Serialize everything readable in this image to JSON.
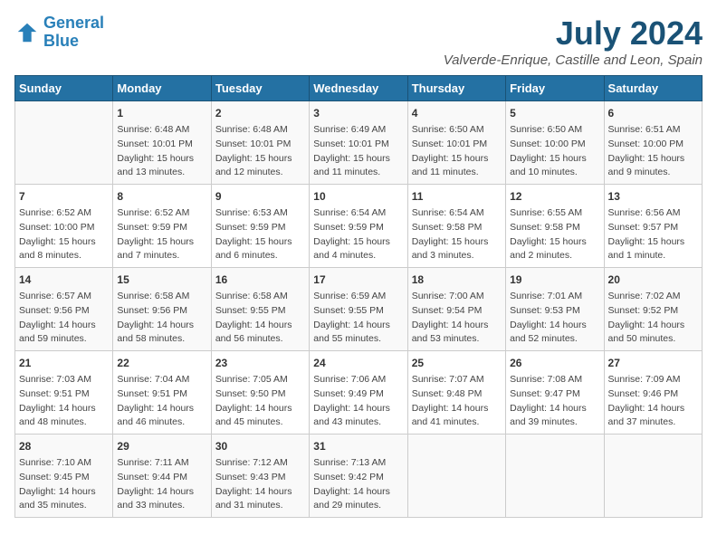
{
  "header": {
    "logo_line1": "General",
    "logo_line2": "Blue",
    "title": "July 2024",
    "subtitle": "Valverde-Enrique, Castille and Leon, Spain"
  },
  "days_of_week": [
    "Sunday",
    "Monday",
    "Tuesday",
    "Wednesday",
    "Thursday",
    "Friday",
    "Saturday"
  ],
  "weeks": [
    [
      {
        "day": "",
        "info": ""
      },
      {
        "day": "1",
        "info": "Sunrise: 6:48 AM\nSunset: 10:01 PM\nDaylight: 15 hours\nand 13 minutes."
      },
      {
        "day": "2",
        "info": "Sunrise: 6:48 AM\nSunset: 10:01 PM\nDaylight: 15 hours\nand 12 minutes."
      },
      {
        "day": "3",
        "info": "Sunrise: 6:49 AM\nSunset: 10:01 PM\nDaylight: 15 hours\nand 11 minutes."
      },
      {
        "day": "4",
        "info": "Sunrise: 6:50 AM\nSunset: 10:01 PM\nDaylight: 15 hours\nand 11 minutes."
      },
      {
        "day": "5",
        "info": "Sunrise: 6:50 AM\nSunset: 10:00 PM\nDaylight: 15 hours\nand 10 minutes."
      },
      {
        "day": "6",
        "info": "Sunrise: 6:51 AM\nSunset: 10:00 PM\nDaylight: 15 hours\nand 9 minutes."
      }
    ],
    [
      {
        "day": "7",
        "info": "Sunrise: 6:52 AM\nSunset: 10:00 PM\nDaylight: 15 hours\nand 8 minutes."
      },
      {
        "day": "8",
        "info": "Sunrise: 6:52 AM\nSunset: 9:59 PM\nDaylight: 15 hours\nand 7 minutes."
      },
      {
        "day": "9",
        "info": "Sunrise: 6:53 AM\nSunset: 9:59 PM\nDaylight: 15 hours\nand 6 minutes."
      },
      {
        "day": "10",
        "info": "Sunrise: 6:54 AM\nSunset: 9:59 PM\nDaylight: 15 hours\nand 4 minutes."
      },
      {
        "day": "11",
        "info": "Sunrise: 6:54 AM\nSunset: 9:58 PM\nDaylight: 15 hours\nand 3 minutes."
      },
      {
        "day": "12",
        "info": "Sunrise: 6:55 AM\nSunset: 9:58 PM\nDaylight: 15 hours\nand 2 minutes."
      },
      {
        "day": "13",
        "info": "Sunrise: 6:56 AM\nSunset: 9:57 PM\nDaylight: 15 hours\nand 1 minute."
      }
    ],
    [
      {
        "day": "14",
        "info": "Sunrise: 6:57 AM\nSunset: 9:56 PM\nDaylight: 14 hours\nand 59 minutes."
      },
      {
        "day": "15",
        "info": "Sunrise: 6:58 AM\nSunset: 9:56 PM\nDaylight: 14 hours\nand 58 minutes."
      },
      {
        "day": "16",
        "info": "Sunrise: 6:58 AM\nSunset: 9:55 PM\nDaylight: 14 hours\nand 56 minutes."
      },
      {
        "day": "17",
        "info": "Sunrise: 6:59 AM\nSunset: 9:55 PM\nDaylight: 14 hours\nand 55 minutes."
      },
      {
        "day": "18",
        "info": "Sunrise: 7:00 AM\nSunset: 9:54 PM\nDaylight: 14 hours\nand 53 minutes."
      },
      {
        "day": "19",
        "info": "Sunrise: 7:01 AM\nSunset: 9:53 PM\nDaylight: 14 hours\nand 52 minutes."
      },
      {
        "day": "20",
        "info": "Sunrise: 7:02 AM\nSunset: 9:52 PM\nDaylight: 14 hours\nand 50 minutes."
      }
    ],
    [
      {
        "day": "21",
        "info": "Sunrise: 7:03 AM\nSunset: 9:51 PM\nDaylight: 14 hours\nand 48 minutes."
      },
      {
        "day": "22",
        "info": "Sunrise: 7:04 AM\nSunset: 9:51 PM\nDaylight: 14 hours\nand 46 minutes."
      },
      {
        "day": "23",
        "info": "Sunrise: 7:05 AM\nSunset: 9:50 PM\nDaylight: 14 hours\nand 45 minutes."
      },
      {
        "day": "24",
        "info": "Sunrise: 7:06 AM\nSunset: 9:49 PM\nDaylight: 14 hours\nand 43 minutes."
      },
      {
        "day": "25",
        "info": "Sunrise: 7:07 AM\nSunset: 9:48 PM\nDaylight: 14 hours\nand 41 minutes."
      },
      {
        "day": "26",
        "info": "Sunrise: 7:08 AM\nSunset: 9:47 PM\nDaylight: 14 hours\nand 39 minutes."
      },
      {
        "day": "27",
        "info": "Sunrise: 7:09 AM\nSunset: 9:46 PM\nDaylight: 14 hours\nand 37 minutes."
      }
    ],
    [
      {
        "day": "28",
        "info": "Sunrise: 7:10 AM\nSunset: 9:45 PM\nDaylight: 14 hours\nand 35 minutes."
      },
      {
        "day": "29",
        "info": "Sunrise: 7:11 AM\nSunset: 9:44 PM\nDaylight: 14 hours\nand 33 minutes."
      },
      {
        "day": "30",
        "info": "Sunrise: 7:12 AM\nSunset: 9:43 PM\nDaylight: 14 hours\nand 31 minutes."
      },
      {
        "day": "31",
        "info": "Sunrise: 7:13 AM\nSunset: 9:42 PM\nDaylight: 14 hours\nand 29 minutes."
      },
      {
        "day": "",
        "info": ""
      },
      {
        "day": "",
        "info": ""
      },
      {
        "day": "",
        "info": ""
      }
    ]
  ]
}
